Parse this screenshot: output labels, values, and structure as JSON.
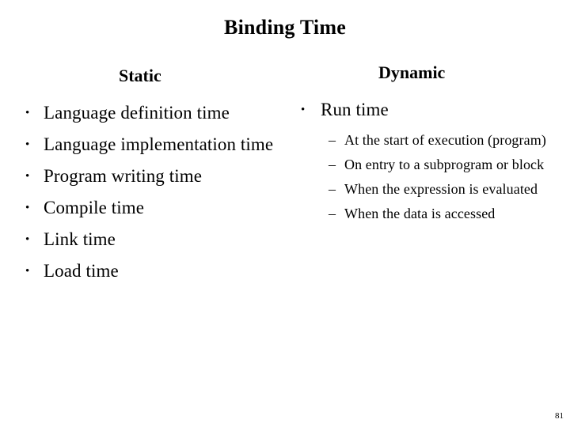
{
  "slide": {
    "title": "Binding Time",
    "page_number": "81",
    "text_color": "#000000",
    "background_color": "#ffffff"
  },
  "columns": {
    "static": {
      "heading": "Static",
      "bullet_marker": "•",
      "items": [
        {
          "text": "Language definition time"
        },
        {
          "text": "Language implementation time"
        },
        {
          "text": "Program writing time"
        },
        {
          "text": "Compile time"
        },
        {
          "text": "Link time"
        },
        {
          "text": "Load time"
        }
      ]
    },
    "dynamic": {
      "heading": "Dynamic",
      "bullet_marker": "•",
      "sub_marker": "–",
      "items": [
        {
          "text": "Run time",
          "subitems": [
            {
              "text": "At the start of execution (program)"
            },
            {
              "text": "On entry to a subprogram or block"
            },
            {
              "text": "When the expression is evaluated"
            },
            {
              "text": "When the data is accessed"
            }
          ]
        }
      ]
    }
  }
}
